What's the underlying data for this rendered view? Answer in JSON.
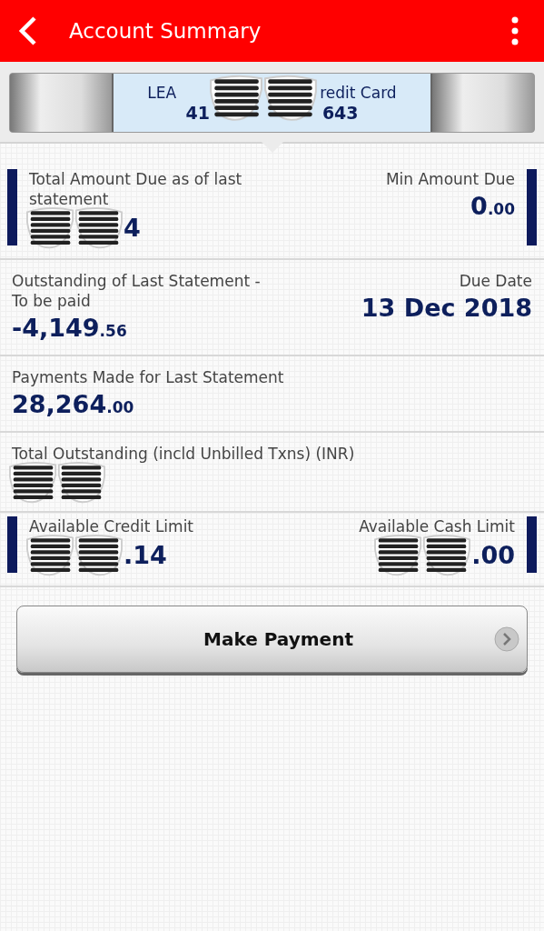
{
  "header": {
    "title": "Account Summary"
  },
  "card_selector": {
    "name_parts": [
      "LEA",
      "redit Card"
    ],
    "number_parts": [
      "41",
      "643"
    ],
    "masked": true
  },
  "summary_rows": [
    {
      "kind": "paired",
      "left": {
        "label": "Total Amount Due as of last statement",
        "masked": true,
        "value": "4"
      },
      "right": {
        "label": "Min Amount Due",
        "masked": false,
        "value": "0",
        "decimals": ".00"
      }
    },
    {
      "kind": "split",
      "left": {
        "label": "Outstanding of Last Statement - To be paid",
        "masked": false,
        "value": "-4,149",
        "decimals": ".56"
      },
      "right": {
        "label": "Due Date",
        "masked": false,
        "value": "13 Dec 2018"
      }
    },
    {
      "kind": "single",
      "left": {
        "label": "Payments Made for Last Statement",
        "masked": false,
        "value": "28,264",
        "decimals": ".00"
      }
    },
    {
      "kind": "single",
      "left": {
        "label": "Total Outstanding (incld Unbilled Txns) (INR)",
        "masked": true
      }
    },
    {
      "kind": "paired",
      "left": {
        "label": "Available Credit Limit",
        "masked": true,
        "value": ".14"
      },
      "right": {
        "label": "Available Cash Limit",
        "masked": true,
        "value": ".00"
      }
    }
  ],
  "action": {
    "label": "Make Payment"
  }
}
